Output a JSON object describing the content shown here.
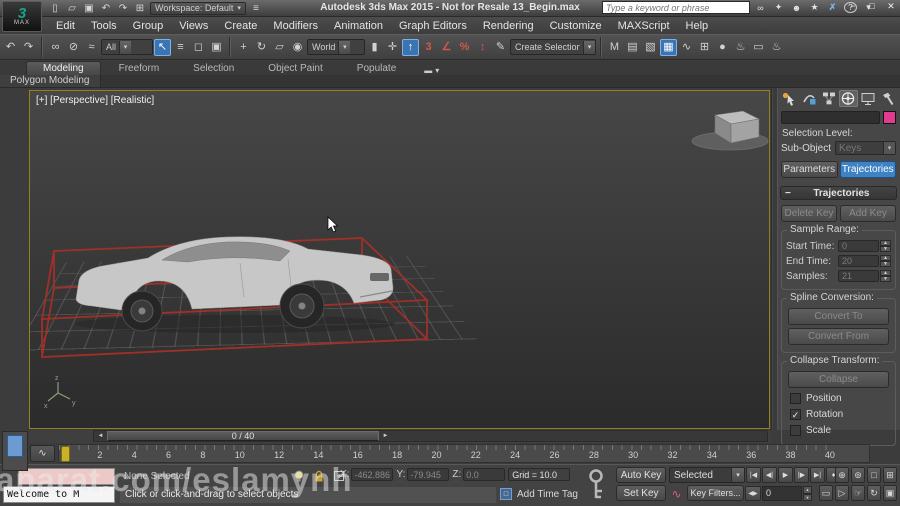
{
  "window": {
    "logo_text": "MAX",
    "title": "Autodesk 3ds Max 2015  - Not for Resale   13_Begin.max",
    "workspace_value": "Workspace: Default",
    "search_placeholder": "Type a keyword or phrase",
    "quick_access": [
      {
        "name": "new-scene-icon",
        "glyph": "▯"
      },
      {
        "name": "open-file-icon",
        "glyph": "▱"
      },
      {
        "name": "save-file-icon",
        "glyph": "▣"
      },
      {
        "name": "undo-icon",
        "glyph": "↶"
      },
      {
        "name": "redo-icon",
        "glyph": "↷"
      },
      {
        "name": "project-folder-icon",
        "glyph": "⊞"
      }
    ],
    "search_icons": [
      {
        "name": "search-icon",
        "glyph": "∞"
      },
      {
        "name": "key-icon",
        "glyph": "✦"
      },
      {
        "name": "sign-in-icon",
        "glyph": "☻"
      },
      {
        "name": "favorites-star-icon",
        "glyph": "★"
      },
      {
        "name": "exchange-icon",
        "glyph": "✗",
        "cls": "blue"
      },
      {
        "name": "help-icon",
        "glyph": "?",
        "cls": "circle"
      },
      {
        "name": "help-menu-arrow-icon",
        "glyph": "▾"
      }
    ],
    "window_icons": [
      {
        "name": "minimize-icon",
        "glyph": "−"
      },
      {
        "name": "maximize-icon",
        "glyph": "□"
      },
      {
        "name": "close-icon",
        "glyph": "✕"
      }
    ]
  },
  "menu_bar": {
    "items": [
      "Edit",
      "Tools",
      "Group",
      "Views",
      "Create",
      "Modifiers",
      "Animation",
      "Graph Editors",
      "Rendering",
      "Customize",
      "MAXScript",
      "Help"
    ]
  },
  "toolbar": {
    "history_icons": [
      {
        "name": "undo-history-icon",
        "glyph": "↶"
      },
      {
        "name": "redo-history-icon",
        "glyph": "↷"
      }
    ],
    "link_icons": [
      {
        "name": "select-and-link-icon",
        "glyph": "∞"
      },
      {
        "name": "unlink-selection-icon",
        "glyph": "⊘"
      },
      {
        "name": "bind-to-space-warp-icon",
        "glyph": "≈"
      }
    ],
    "filter_value": "All",
    "select_icons": [
      {
        "name": "select-object-icon",
        "glyph": "↖",
        "cls": "active"
      },
      {
        "name": "select-by-name-icon",
        "glyph": "≡"
      },
      {
        "name": "rectangular-selection-icon",
        "glyph": "◻"
      },
      {
        "name": "window-crossing-icon",
        "glyph": "▣"
      }
    ],
    "transform_icons": [
      {
        "name": "select-and-move-icon",
        "glyph": "+"
      },
      {
        "name": "select-and-rotate-icon",
        "glyph": "↻"
      },
      {
        "name": "select-and-scale-icon",
        "glyph": "▱"
      },
      {
        "name": "select-and-place-icon",
        "glyph": "◉"
      }
    ],
    "coord_value": "World",
    "pivot_icons": [
      {
        "name": "use-pivot-point-icon",
        "glyph": "▮"
      },
      {
        "name": "select-and-manipulate-icon",
        "glyph": "✛"
      },
      {
        "name": "keyboard-override-icon",
        "glyph": "↑",
        "cls": "active"
      }
    ],
    "snap_icons": [
      {
        "name": "snaps-toggle-3d-icon",
        "glyph": "3",
        "cls": "red"
      },
      {
        "name": "angle-snap-icon",
        "glyph": "∠",
        "cls": "red"
      },
      {
        "name": "percent-snap-icon",
        "glyph": "%",
        "cls": "red"
      },
      {
        "name": "spinner-snap-icon",
        "glyph": "↕",
        "cls": "red"
      }
    ],
    "sets_icons": [
      {
        "name": "edit-named-selection-sets-icon",
        "glyph": "✎"
      }
    ],
    "sets_value": "Create Selection Set",
    "right_icons": [
      {
        "name": "mirror-icon",
        "glyph": "M"
      },
      {
        "name": "align-icon",
        "glyph": "▤"
      },
      {
        "name": "layer-manager-icon",
        "glyph": "▧"
      },
      {
        "name": "toggle-ribbon-icon",
        "glyph": "▦",
        "cls": "active"
      },
      {
        "name": "curve-editor-icon",
        "glyph": "∿"
      },
      {
        "name": "schematic-view-icon",
        "glyph": "⊞"
      },
      {
        "name": "material-editor-icon",
        "glyph": "●"
      },
      {
        "name": "render-setup-icon",
        "glyph": "♨"
      },
      {
        "name": "rendered-frame-icon",
        "glyph": "▭"
      },
      {
        "name": "render-production-icon",
        "glyph": "♨"
      }
    ]
  },
  "ribbon": {
    "tabs": [
      {
        "label": "Modeling",
        "cls": "active"
      },
      {
        "label": "Freeform"
      },
      {
        "label": "Selection"
      },
      {
        "label": "Object Paint"
      },
      {
        "label": "Populate"
      }
    ],
    "minimize_glyph": "▬",
    "minimize_arrow": "▾",
    "panel_label": "Polygon Modeling"
  },
  "viewport": {
    "label": "[+] [Perspective] [Realistic]"
  },
  "command_panel": {
    "tabs": [
      "Create",
      "Modify",
      "Hierarchy",
      "Motion",
      "Display",
      "Utilities"
    ],
    "active_tab": "Motion",
    "object_name_value": "",
    "color_swatch": "#e13a8e",
    "selection_level_label": "Selection Level:",
    "sub_object_label": "Sub-Object",
    "sub_object_value": "Keys",
    "parameters_button": "Parameters",
    "trajectories_button": "Trajectories",
    "rollout_collapse_glyph": "−",
    "rollout_title": "Trajectories",
    "delete_key_button": "Delete Key",
    "add_key_button": "Add Key",
    "sample_range_title": "Sample Range:",
    "sample_fields": [
      {
        "label": "Start Time:",
        "value": "0"
      },
      {
        "label": "End Time:",
        "value": "20"
      },
      {
        "label": "Samples:",
        "value": "21"
      }
    ],
    "spline_title": "Spline Conversion:",
    "spline_buttons": [
      "Convert To",
      "Convert From"
    ],
    "collapse_title": "Collapse Transform:",
    "collapse_button": "Collapse",
    "collapse_checkboxes": [
      {
        "label": "Position",
        "checked": false
      },
      {
        "label": "Rotation",
        "checked": true
      },
      {
        "label": "Scale",
        "checked": false
      }
    ]
  },
  "timeline": {
    "slider_value": "0 / 40",
    "left_arrow": "◄",
    "right_arrow": "►",
    "curve_editor_glyph": "∿",
    "ticks": [
      "0",
      "2",
      "4",
      "6",
      "8",
      "10",
      "12",
      "14",
      "16",
      "18",
      "20",
      "22",
      "24",
      "26",
      "28",
      "30",
      "32",
      "34",
      "36",
      "38",
      "40"
    ]
  },
  "status_bar": {
    "listener_text": "Welcome to M",
    "selection_status": "None Selected",
    "prompt": "Click or click-and-drag to select objects",
    "coords": [
      {
        "label": "X:",
        "value": "-462.886"
      },
      {
        "label": "Y:",
        "value": "-79.945"
      },
      {
        "label": "Z:",
        "value": "0.0"
      }
    ],
    "grid_label": "Grid = 10.0",
    "add_time_tag": "Add Time Tag",
    "auto_key": "Auto Key",
    "set_key": "Set Key",
    "selected_value": "Selected",
    "key_filters": "Key Filters...",
    "frame_value": "0",
    "key_step_glyph": "◀▶",
    "tangent_glyph": "∿",
    "playback_icons": [
      {
        "name": "go-to-start-icon",
        "glyph": "|◀"
      },
      {
        "name": "previous-frame-icon",
        "glyph": "◀|"
      },
      {
        "name": "play-animation-icon",
        "glyph": "▶"
      },
      {
        "name": "next-frame-icon",
        "glyph": "|▶"
      },
      {
        "name": "go-to-end-icon",
        "glyph": "▶|"
      },
      {
        "name": "key-mode-toggle-icon",
        "glyph": "♦"
      }
    ],
    "nav_icons_row1": [
      {
        "name": "zoom-icon",
        "glyph": "⊕"
      },
      {
        "name": "zoom-all-icon",
        "glyph": "⊚"
      },
      {
        "name": "zoom-extents-icon",
        "glyph": "□"
      },
      {
        "name": "zoom-extents-all-icon",
        "glyph": "⊞"
      }
    ],
    "nav_icons_row2": [
      {
        "name": "zoom-region-icon",
        "glyph": "▭"
      },
      {
        "name": "field-of-view-icon",
        "glyph": "▷"
      },
      {
        "name": "pan-view-icon",
        "glyph": "☞"
      },
      {
        "name": "orbit-icon",
        "glyph": "↻"
      },
      {
        "name": "maximize-viewport-icon",
        "glyph": "▣"
      }
    ]
  },
  "watermark": "anarat.com/eslamynh",
  "colors": {
    "accent_blue": "#3f82c4",
    "toolbar_active_blue": "#3a74b4",
    "magenta_swatch": "#e13a8e",
    "trajectory_red": "#a63028",
    "frame_marker_yellow": "#c9b227",
    "viewport_border": "#96801e"
  }
}
